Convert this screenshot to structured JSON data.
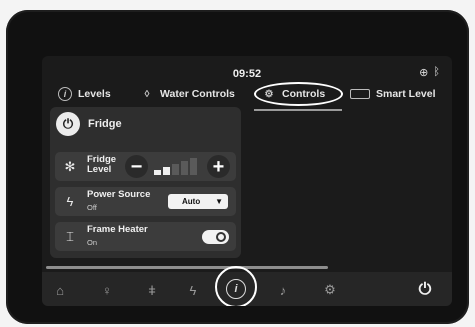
{
  "status": {
    "time": "09:52",
    "icons": [
      "globe-icon",
      "bluetooth-icon"
    ]
  },
  "tabs": [
    {
      "label": "Levels",
      "icon": "info-circle-icon"
    },
    {
      "label": "Water Controls",
      "icon": "water-drop-icon"
    },
    {
      "label": "Controls",
      "icon": "gears-icon",
      "active": true
    },
    {
      "label": "Smart Level",
      "icon": "level-rect-icon"
    }
  ],
  "fridge": {
    "title": "Fridge",
    "power_icon": "power-icon",
    "level": {
      "label_line1": "Fridge",
      "label_line2": "Level",
      "icon": "snowflake-icon",
      "minus": "−",
      "plus": "+",
      "bars_total": 5,
      "bars_active": 2
    },
    "power_source": {
      "label": "Power Source",
      "status": "Off",
      "icon": "lightning-icon",
      "selected": "Auto"
    },
    "frame_heater": {
      "label": "Frame Heater",
      "status": "On",
      "icon": "heater-icon",
      "toggle_on": true
    }
  },
  "bottom_nav": [
    {
      "name": "home",
      "icon": "home-icon"
    },
    {
      "name": "lighting",
      "icon": "lightbulb-icon"
    },
    {
      "name": "temperature",
      "icon": "thermometer-icon"
    },
    {
      "name": "power",
      "icon": "lightning-icon"
    },
    {
      "name": "info",
      "icon": "info-icon",
      "active": true
    },
    {
      "name": "music",
      "icon": "music-note-icon"
    },
    {
      "name": "settings",
      "icon": "gear-icon"
    },
    {
      "name": "shutdown",
      "icon": "power-off-icon"
    }
  ],
  "colors": {
    "screen_bg": "#1b1b1b",
    "panel_bg": "#2e2e2e",
    "row_bg": "#3c3c3c",
    "bar_active": "#f0f0f0",
    "bar_inactive": "#5a5a5a"
  }
}
